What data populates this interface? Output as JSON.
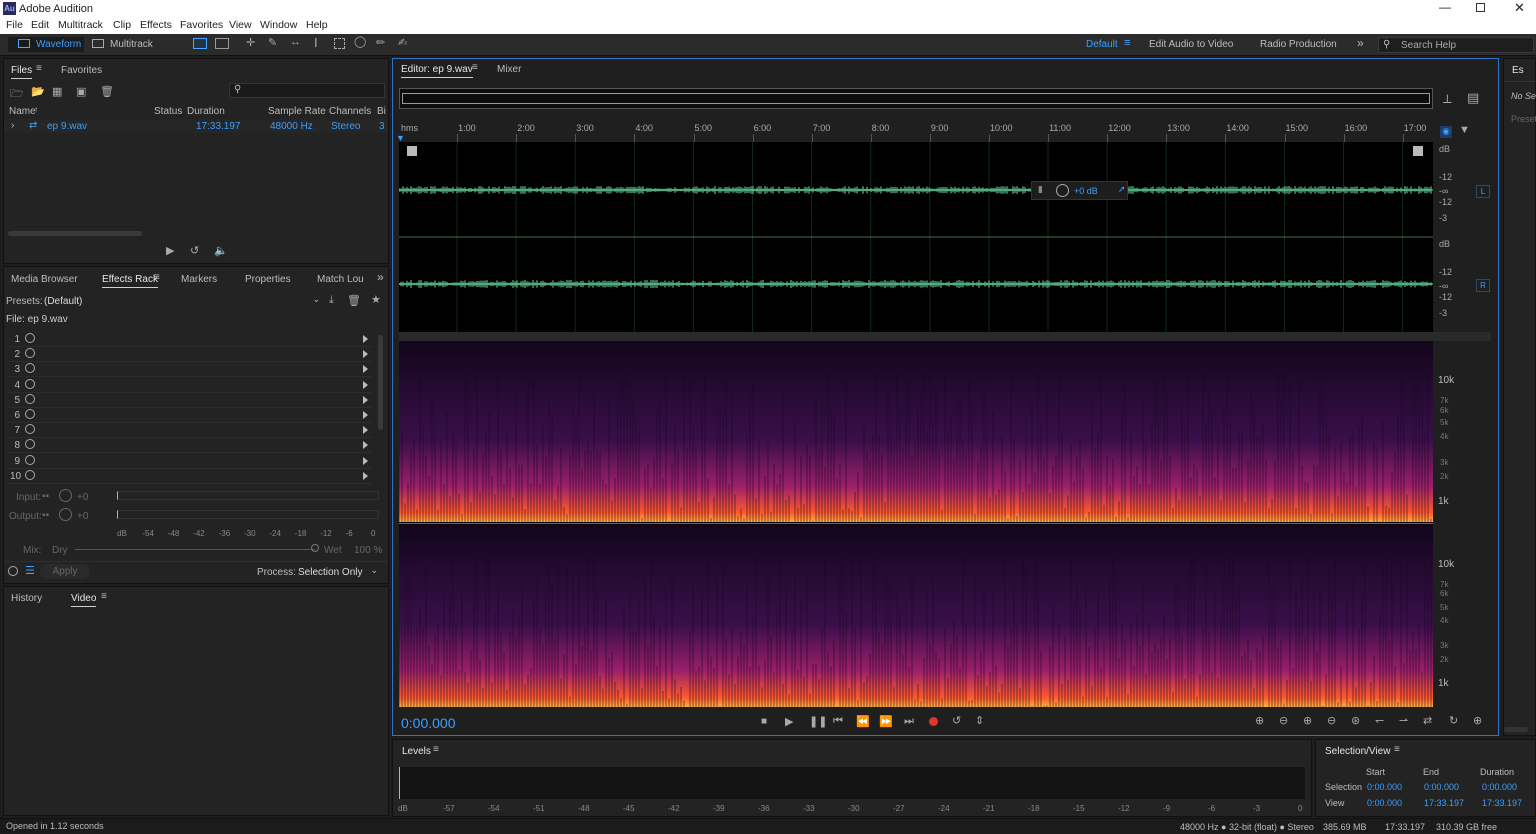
{
  "window": {
    "title": "Adobe Audition",
    "app_icon": "Au"
  },
  "menu": [
    "File",
    "Edit",
    "Multitrack",
    "Clip",
    "Effects",
    "Favorites",
    "View",
    "Window",
    "Help"
  ],
  "toolbar": {
    "waveform": "Waveform",
    "multitrack": "Multitrack",
    "workspaces": [
      "Default",
      "Edit Audio to Video",
      "Radio Production"
    ],
    "search_placeholder": "Search Help"
  },
  "files_panel": {
    "tabs": [
      "Files",
      "Favorites"
    ],
    "columns": [
      "Name",
      "Status",
      "Duration",
      "Sample Rate",
      "Channels",
      "Bi"
    ],
    "file": {
      "name": "ep 9.wav",
      "duration": "17:33.197",
      "sample_rate": "48000 Hz",
      "channels": "Stereo",
      "bits": "3"
    }
  },
  "effects_panel": {
    "tabs": [
      "Media Browser",
      "Effects Rack",
      "Markers",
      "Properties",
      "Match Lou"
    ],
    "presets_label": "Presets:",
    "preset_value": "(Default)",
    "file_label": "File: ep 9.wav",
    "slots": [
      "1",
      "2",
      "3",
      "4",
      "5",
      "6",
      "7",
      "8",
      "9",
      "10"
    ],
    "input_label": "Input:",
    "output_label": "Output:",
    "input_value": "+0",
    "output_value": "+0",
    "meter_ticks": [
      "dB",
      "-54",
      "-48",
      "-42",
      "-36",
      "-30",
      "-24",
      "-18",
      "-12",
      "-6",
      "0"
    ],
    "mix_label": "Mix:",
    "dry": "Dry",
    "wet": "Wet",
    "wet_value": "100 %",
    "apply": "Apply",
    "process_label": "Process:",
    "process_value": "Selection Only"
  },
  "history_panel": {
    "tabs": [
      "History",
      "Video"
    ]
  },
  "editor": {
    "tabs": [
      "Editor: ep 9.wav",
      "Mixer"
    ],
    "time_ruler": [
      "hms",
      "1:00",
      "2:00",
      "3:00",
      "4:00",
      "5:00",
      "6:00",
      "7:00",
      "8:00",
      "9:00",
      "10:00",
      "11:00",
      "12:00",
      "13:00",
      "14:00",
      "15:00",
      "16:00",
      "17:00"
    ],
    "hud_value": "+0 dB",
    "db_scale_left": [
      "dB",
      "-12",
      "-∞",
      "-12",
      "-3"
    ],
    "db_scale_right": [
      "dB",
      "-12",
      "-∞",
      "-12",
      "-3"
    ],
    "channel_l": "L",
    "channel_r": "R",
    "freq_labels_top": [
      "10k",
      "7k",
      "6k",
      "5k",
      "4k",
      "3k",
      "2k",
      "1k"
    ],
    "freq_labels_bottom": [
      "10k",
      "7k",
      "6k",
      "5k",
      "4k",
      "3k",
      "2k",
      "1k"
    ],
    "current_time": "0:00.000"
  },
  "right_panel": {
    "tab": "Es",
    "text1": "No Sel",
    "text2": "Preset"
  },
  "levels": {
    "title": "Levels",
    "ticks": [
      "dB",
      "-57",
      "-54",
      "-51",
      "-48",
      "-45",
      "-42",
      "-39",
      "-36",
      "-33",
      "-30",
      "-27",
      "-24",
      "-21",
      "-18",
      "-15",
      "-12",
      "-9",
      "-6",
      "-3",
      "0"
    ]
  },
  "selection_view": {
    "title": "Selection/View",
    "headers": [
      "Start",
      "End",
      "Duration"
    ],
    "selection": {
      "label": "Selection",
      "start": "0:00.000",
      "end": "0:00.000",
      "duration": "0:00.000"
    },
    "view": {
      "label": "View",
      "start": "0:00.000",
      "end": "17:33.197",
      "duration": "17:33.197"
    }
  },
  "status": {
    "left": "Opened in 1.12 seconds",
    "format": "48000 Hz ● 32-bit (float) ● Stereo",
    "size": "385.69 MB",
    "duration": "17:33.197",
    "free": "310.39 GB free"
  },
  "colors": {
    "accent": "#3aa0ff",
    "waveform": "#6fe3a7",
    "record": "#e0362c",
    "spectral_hot": "#ff5a2a",
    "spectral_mid": "#9a1f6a"
  }
}
